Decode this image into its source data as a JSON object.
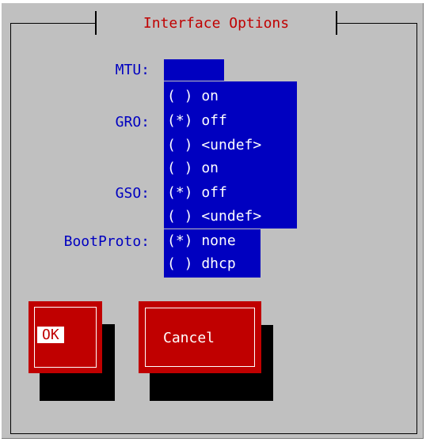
{
  "dialog": {
    "title": "Interface Options"
  },
  "fields": {
    "mtu_label": "MTU:",
    "mtu_value": "",
    "gro_label": "GRO:",
    "gro_options": [
      "( ) on",
      "(*) off",
      "( ) <undef>"
    ],
    "gso_label": "GSO:",
    "gso_options": [
      "( ) on",
      "(*) off",
      "( ) <undef>"
    ],
    "bootproto_label": "BootProto:",
    "bootproto_options": [
      "(*) none",
      "( ) dhcp"
    ]
  },
  "buttons": {
    "ok_label": "OK",
    "cancel_label": "Cancel"
  },
  "colors": {
    "dialog_bg": "#c0c0c0",
    "label_text": "#0000c0",
    "field_bg": "#0000c0",
    "button_bg": "#c00000",
    "title_text": "#c00000"
  }
}
